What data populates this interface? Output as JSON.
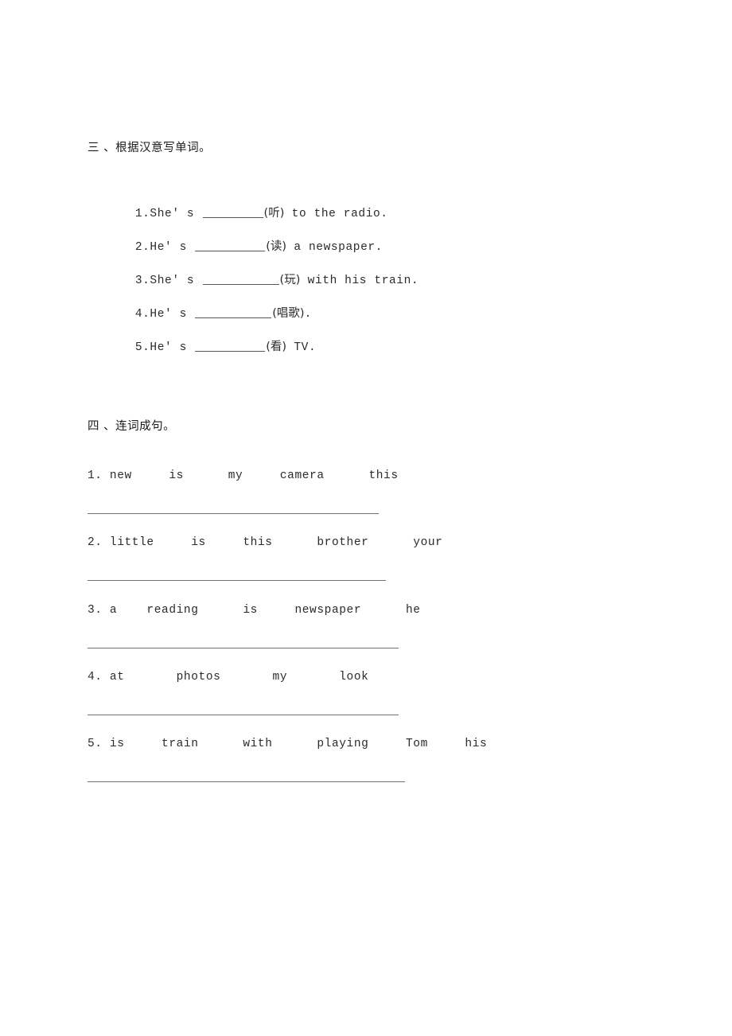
{
  "document": {
    "background_color": "#ffffff",
    "text_color": "#2b2b2b",
    "rule_color": "#6f6f74"
  },
  "sections": [
    {
      "id": "section-three",
      "heading": "三 、根据汉意写单词。",
      "type": "fill-in-the-blank",
      "items": [
        {
          "number": "1.",
          "before": "She' s ",
          "blank_chars": 8,
          "hint": "(听)",
          "after": " to the radio."
        },
        {
          "number": "2.",
          "before": "He' s ",
          "blank_chars": 10,
          "hint": "(读)",
          "after": " a newspaper."
        },
        {
          "number": "3.",
          "before": "She' s ",
          "blank_chars": 11,
          "hint": "(玩)",
          "after": " with his train."
        },
        {
          "number": "4.",
          "before": "He' s ",
          "blank_chars": 11,
          "hint": "(唱歌)",
          "after": "."
        },
        {
          "number": "5.",
          "before": "He' s ",
          "blank_chars": 10,
          "hint": "(看)",
          "after": " TV."
        }
      ]
    },
    {
      "id": "section-four",
      "heading": "四 、连词成句。",
      "type": "word-ordering",
      "items": [
        {
          "number": "1.",
          "words": [
            "new",
            "is",
            "my",
            "camera",
            "this"
          ],
          "text": "1. new     is      my     camera      this",
          "rule_width": 366
        },
        {
          "number": "2.",
          "words": [
            "little",
            "is",
            "this",
            "brother",
            "your"
          ],
          "text": "2. little     is     this      brother      your",
          "rule_width": 375
        },
        {
          "number": "3.",
          "words": [
            "a",
            "reading",
            "is",
            "newspaper",
            "he"
          ],
          "text": "3. a    reading      is     newspaper      he",
          "rule_width": 391
        },
        {
          "number": "4.",
          "words": [
            "at",
            "photos",
            "my",
            "look"
          ],
          "text": "4. at       photos       my       look",
          "rule_width": 391
        },
        {
          "number": "5.",
          "words": [
            "is",
            "train",
            "with",
            "playing",
            "Tom",
            "his"
          ],
          "text": "5. is     train      with      playing     Tom     his",
          "rule_width": 399
        }
      ]
    }
  ]
}
